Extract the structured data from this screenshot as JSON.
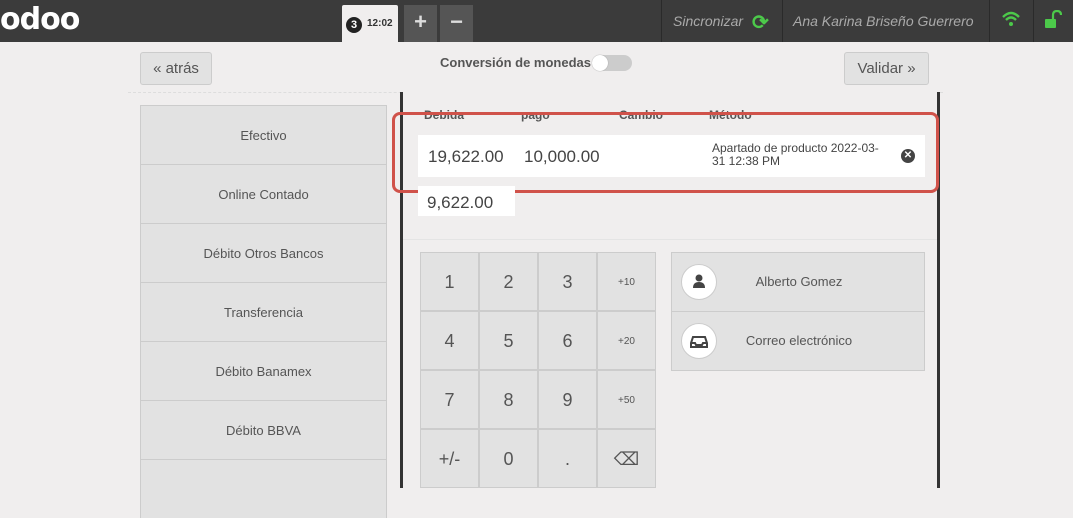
{
  "header": {
    "logo": "odoo",
    "order_number": "3",
    "order_time": "12:02",
    "add_label": "+",
    "remove_label": "−",
    "sync_label": "Sincronizar",
    "user_name": "Ana Karina Briseño Guerrero"
  },
  "toolbar": {
    "back_label": "« atrás",
    "validate_label": "Validar »",
    "currency_conversion_label": "Conversión de monedas"
  },
  "payment_methods": [
    "Efectivo",
    "Online Contado",
    "Débito Otros Bancos",
    "Transferencia",
    "Débito Banamex",
    "Débito BBVA"
  ],
  "paymentlines": {
    "headers": [
      "Debida",
      "pago",
      "Cambio",
      "Método"
    ],
    "rows": [
      {
        "due": "19,622.00",
        "tendered": "10,000.00",
        "change": "",
        "method": "Apartado de producto 2022-03-31 12:38 PM"
      }
    ],
    "remaining": "9,622.00"
  },
  "numpad": [
    "1",
    "2",
    "3",
    "+10",
    "4",
    "5",
    "6",
    "+20",
    "7",
    "8",
    "9",
    "+50",
    "+/-",
    "0",
    ".",
    "⌫"
  ],
  "customer": {
    "name": "Alberto Gomez"
  },
  "email_label": "Correo electrónico",
  "colors": {
    "header_bg": "#3b3b3b",
    "sync_green": "#4cc94a",
    "highlight": "#d0524a"
  }
}
